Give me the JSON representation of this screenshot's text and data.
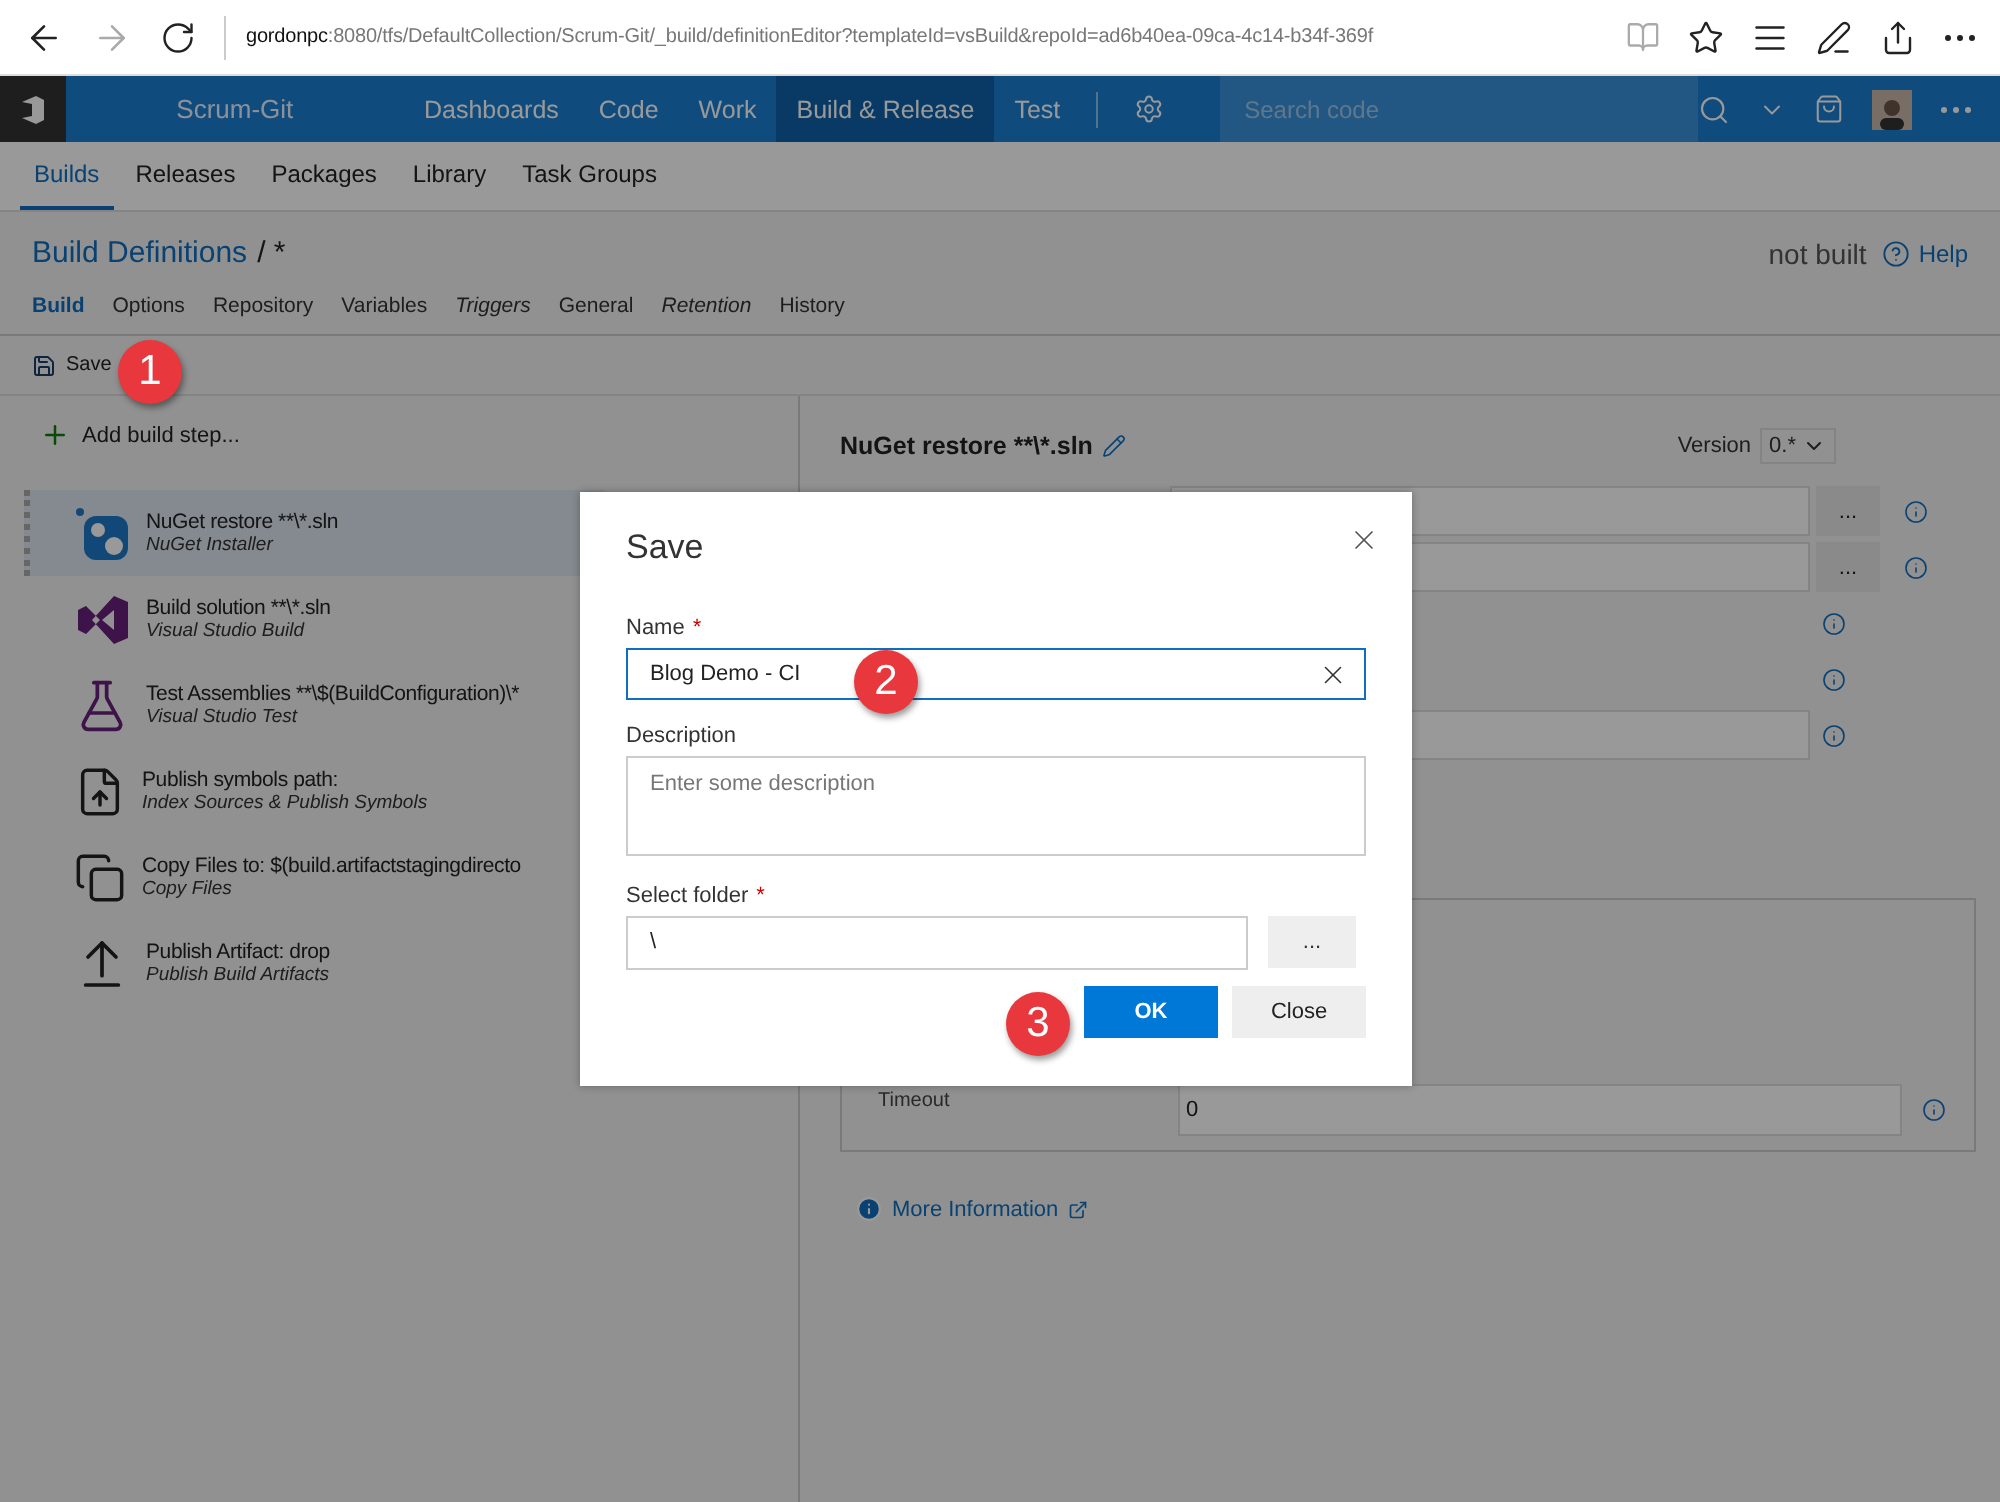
{
  "browser": {
    "url_host": "gordonpc",
    "url_rest": ":8080/tfs/DefaultCollection/Scrum-Git/_build/definitionEditor?templateId=vsBuild&repoId=ad6b40ea-09ca-4c14-b34f-369f"
  },
  "topbar": {
    "project": "Scrum-Git",
    "nav": [
      {
        "label": "Dashboards",
        "selected": false
      },
      {
        "label": "Code",
        "selected": false
      },
      {
        "label": "Work",
        "selected": false
      },
      {
        "label": "Build & Release",
        "selected": true
      },
      {
        "label": "Test",
        "selected": false
      }
    ],
    "search": {
      "placeholder": "Search code"
    }
  },
  "subnav": [
    {
      "label": "Builds",
      "selected": true
    },
    {
      "label": "Releases",
      "selected": false
    },
    {
      "label": "Packages",
      "selected": false
    },
    {
      "label": "Library",
      "selected": false
    },
    {
      "label": "Task Groups",
      "selected": false
    }
  ],
  "header": {
    "breadcrumb_link": "Build Definitions",
    "breadcrumb_rest": "/ *",
    "status": "not built",
    "help": "Help"
  },
  "tabs": [
    {
      "label": "Build",
      "selected": true,
      "italic": false
    },
    {
      "label": "Options",
      "selected": false,
      "italic": false
    },
    {
      "label": "Repository",
      "selected": false,
      "italic": false
    },
    {
      "label": "Variables",
      "selected": false,
      "italic": false
    },
    {
      "label": "Triggers",
      "selected": false,
      "italic": true
    },
    {
      "label": "General",
      "selected": false,
      "italic": false
    },
    {
      "label": "Retention",
      "selected": false,
      "italic": true
    },
    {
      "label": "History",
      "selected": false,
      "italic": false
    }
  ],
  "toolbar": {
    "save": "Save"
  },
  "steps_panel": {
    "add": "Add build step...",
    "steps": [
      {
        "kind": "nuget",
        "title": "NuGet restore **\\*.sln",
        "subtitle": "NuGet Installer",
        "selected": true
      },
      {
        "kind": "vs",
        "title": "Build solution **\\*.sln",
        "subtitle": "Visual Studio Build",
        "selected": false
      },
      {
        "kind": "test",
        "title": "Test Assemblies **\\$(BuildConfiguration)\\*",
        "subtitle": "Visual Studio Test",
        "selected": false
      },
      {
        "kind": "symbols",
        "title": "Publish symbols path:",
        "subtitle": "Index Sources & Publish Symbols",
        "selected": false
      },
      {
        "kind": "copy",
        "title": "Copy Files to: $(build.artifactstagingdirecto",
        "subtitle": "Copy Files",
        "selected": false
      },
      {
        "kind": "publish",
        "title": "Publish Artifact: drop",
        "subtitle": "Publish Build Artifacts",
        "selected": false
      }
    ]
  },
  "details": {
    "title": "NuGet restore **\\*.sln",
    "version_label": "Version",
    "version": "0.*",
    "fields": [
      {
        "kind": "browse",
        "button": "..."
      },
      {
        "kind": "browse",
        "button": "..."
      },
      {
        "kind": "flag"
      },
      {
        "kind": "flag"
      },
      {
        "kind": "text"
      }
    ],
    "timeout_label": "Timeout",
    "timeout_value": "0",
    "more_info": "More Information"
  },
  "dialog": {
    "title": "Save",
    "name_label": "Name",
    "required_mark": "*",
    "name_value": "Blog Demo - CI",
    "description_label": "Description",
    "description_placeholder": "Enter some description",
    "folder_label": "Select folder",
    "folder_value": "\\",
    "browse": "...",
    "ok": "OK",
    "close": "Close"
  },
  "callouts": [
    "1",
    "2",
    "3"
  ]
}
